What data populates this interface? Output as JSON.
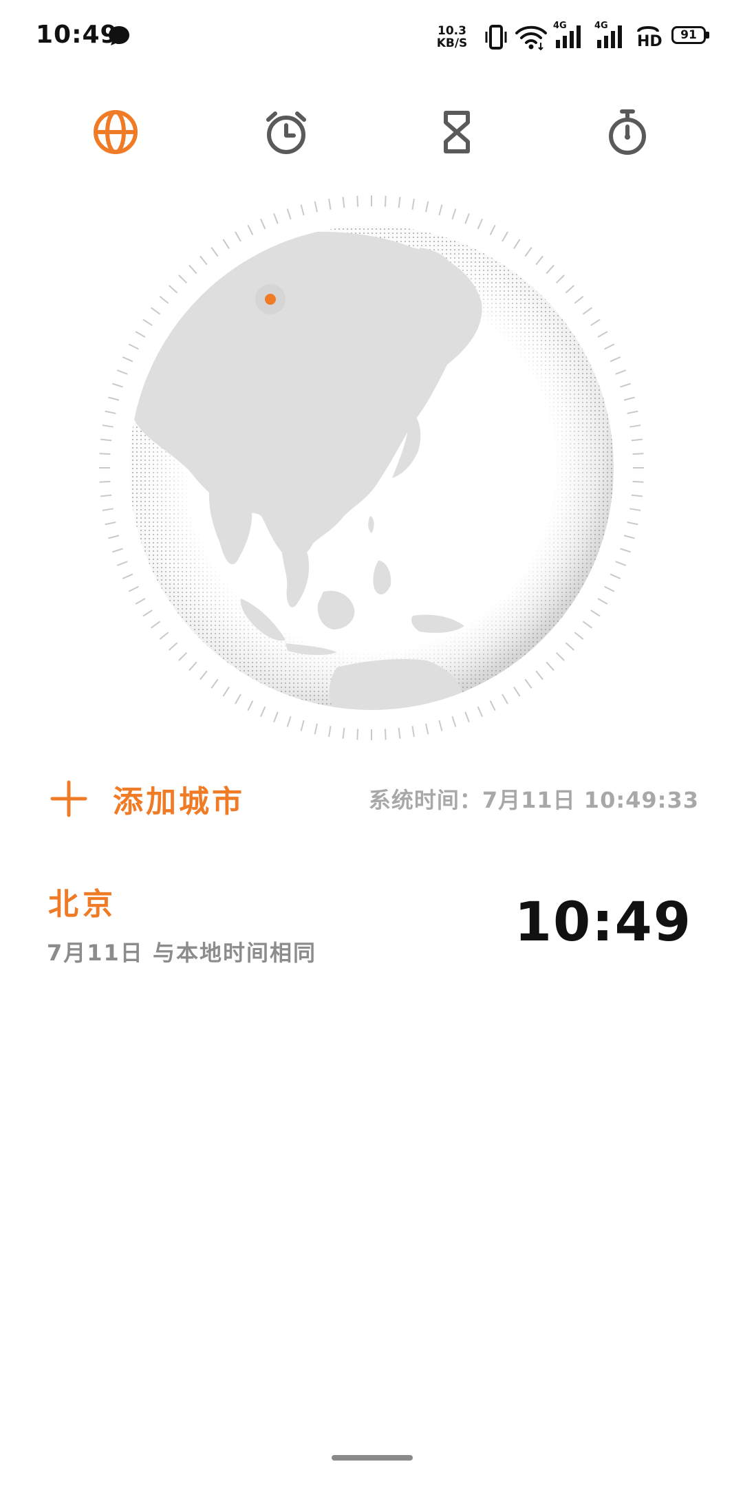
{
  "status_bar": {
    "time": "10:49",
    "net_speed_value": "10.3",
    "net_speed_unit": "KB/S",
    "signal1_label": "4G",
    "signal2_label": "4G",
    "hd_label": "HD",
    "battery": "91"
  },
  "tabs": [
    {
      "name": "world-clock",
      "icon": "globe-icon",
      "active": true
    },
    {
      "name": "alarm",
      "icon": "alarm-clock-icon",
      "active": false
    },
    {
      "name": "timer",
      "icon": "hourglass-icon",
      "active": false
    },
    {
      "name": "stopwatch",
      "icon": "stopwatch-icon",
      "active": false
    }
  ],
  "globe": {
    "marker_city": "北京"
  },
  "actions": {
    "add_city_label": "添加城市",
    "system_time": "系统时间：7月11日 10:49:33"
  },
  "cities": [
    {
      "name": "北京",
      "subtitle": "7月11日 与本地时间相同",
      "time": "10:49"
    }
  ],
  "colors": {
    "accent": "#f07b27",
    "inactive_icon": "#5a5a5a",
    "secondary_text": "#a8a8a8"
  }
}
